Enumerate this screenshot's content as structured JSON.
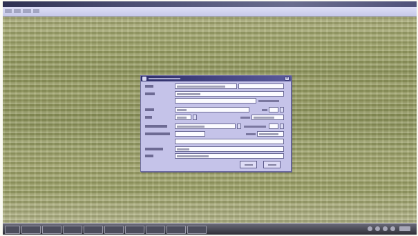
{
  "window": {
    "menu_count": 4
  },
  "dialog": {
    "title_icon": "dialog-icon",
    "close_icon": "close-icon",
    "rows": 11,
    "buttons": 2
  },
  "taskbar": {
    "buttons": 10,
    "tray_icons": 5
  },
  "colors": {
    "desktop": "#9a9f66",
    "dialog_bg": "#c5c3e9",
    "dialog_titlebar": "#2f2f6a",
    "menubar": "#d2d3f0",
    "taskbar": "#3a3b46"
  }
}
